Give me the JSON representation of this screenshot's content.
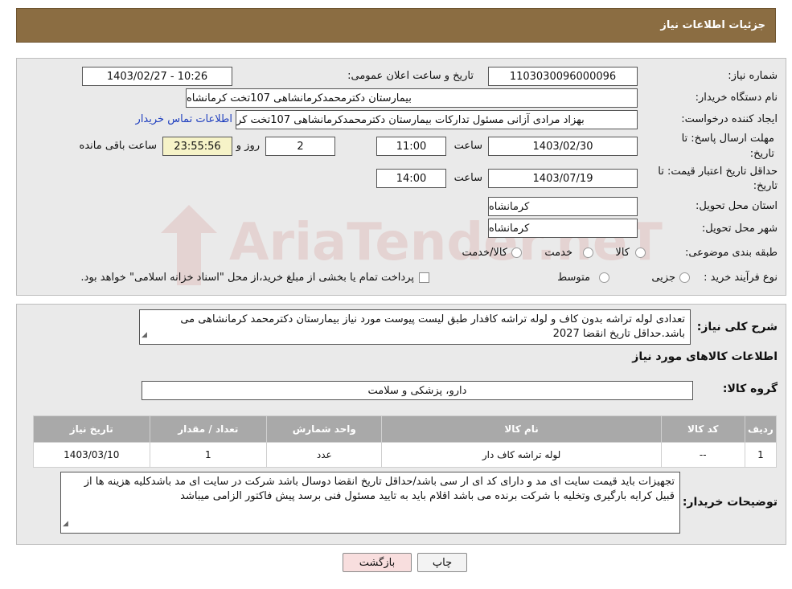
{
  "header": {
    "title": "جزئیات اطلاعات نیاز"
  },
  "form": {
    "need_number_label": "شماره نیاز:",
    "need_number": "1103030096000096",
    "announce_label": "تاریخ و ساعت اعلان عمومی:",
    "announce_value": "1403/02/27 - 10:26",
    "buyer_label": "نام دستگاه خریدار:",
    "buyer_value": "بیمارستان دکترمحمدکرمانشاهی 107تخت کرمانشاه",
    "creator_label": "ایجاد کننده درخواست:",
    "creator_value": "بهزاد مرادی آزانی مسئول تداركات بیمارستان دکترمحمدکرمانشاهی 107تخت کر",
    "contact_link": "اطلاعات تماس خریدار",
    "deadline_label_1": "مهلت ارسال پاسخ: تا",
    "deadline_label_2": "تاریخ:",
    "deadline_date": "1403/02/30",
    "time_label": "ساعت",
    "deadline_time": "11:00",
    "days_value": "2",
    "days_label": "روز و",
    "remaining_time": "23:55:56",
    "remaining_label": "ساعت باقی مانده",
    "validity_label_1": "حداقل تاریخ اعتبار قیمت: تا",
    "validity_label_2": "تاریخ:",
    "validity_date": "1403/07/19",
    "validity_time": "14:00",
    "province_label": "استان محل تحویل:",
    "province_value": "کرمانشاه",
    "city_label": "شهر محل تحویل:",
    "city_value": "کرمانشاه",
    "category_label": "طبقه بندی موضوعی:",
    "category_options": [
      "کالا",
      "خدمت",
      "کالا/خدمت"
    ],
    "process_label": "نوع فرآیند خرید :",
    "process_options": [
      "جزیی",
      "متوسط"
    ],
    "process_note": "پرداخت تمام یا بخشی از مبلغ خرید،از محل \"اسناد خزانه اسلامی\" خواهد بود."
  },
  "description": {
    "label": "شرح کلی نیاز:",
    "text": "تعدادی لوله تراشه بدون کاف و لوله تراشه کافدار طبق لیست پیوست  مورد نیاز بیمارستان دکترمحمد کرمانشاهی می باشد.حداقل تاریخ انقضا 2027"
  },
  "goods": {
    "section_title": "اطلاعات کالاهای مورد نیاز",
    "group_label": "گروه کالا:",
    "group_value": "دارو، پزشکی و سلامت",
    "columns": [
      "ردیف",
      "کد کالا",
      "نام کالا",
      "واحد شمارش",
      "تعداد / مقدار",
      "تاریخ نیاز"
    ],
    "rows": [
      [
        "1",
        "--",
        "لوله تراشه کاف دار",
        "عدد",
        "1",
        "1403/03/10"
      ]
    ]
  },
  "buyer_notes": {
    "label": "توضیحات خریدار:",
    "text": "تجهیزات باید قیمت سایت ای مد و دارای کد ای ار سی باشد/حداقل تاریخ انقضا دوسال باشد شرکت در سایت ای مد باشدکلیه هزینه ها از قبیل کرایه بارگیری وتخلیه با شرکت برنده می باشد اقلام باید به تایید مسئول فنی برسد پیش فاکتور الزامی میباشد"
  },
  "buttons": {
    "print": "چاپ",
    "back": "بازگشت"
  },
  "watermark": {
    "text": "AriaTender.neT"
  },
  "colors": {
    "header": "#8b6d42",
    "table_header": "#a9a9a9",
    "link": "#1f3fbf",
    "back_button": "#f8dede"
  }
}
